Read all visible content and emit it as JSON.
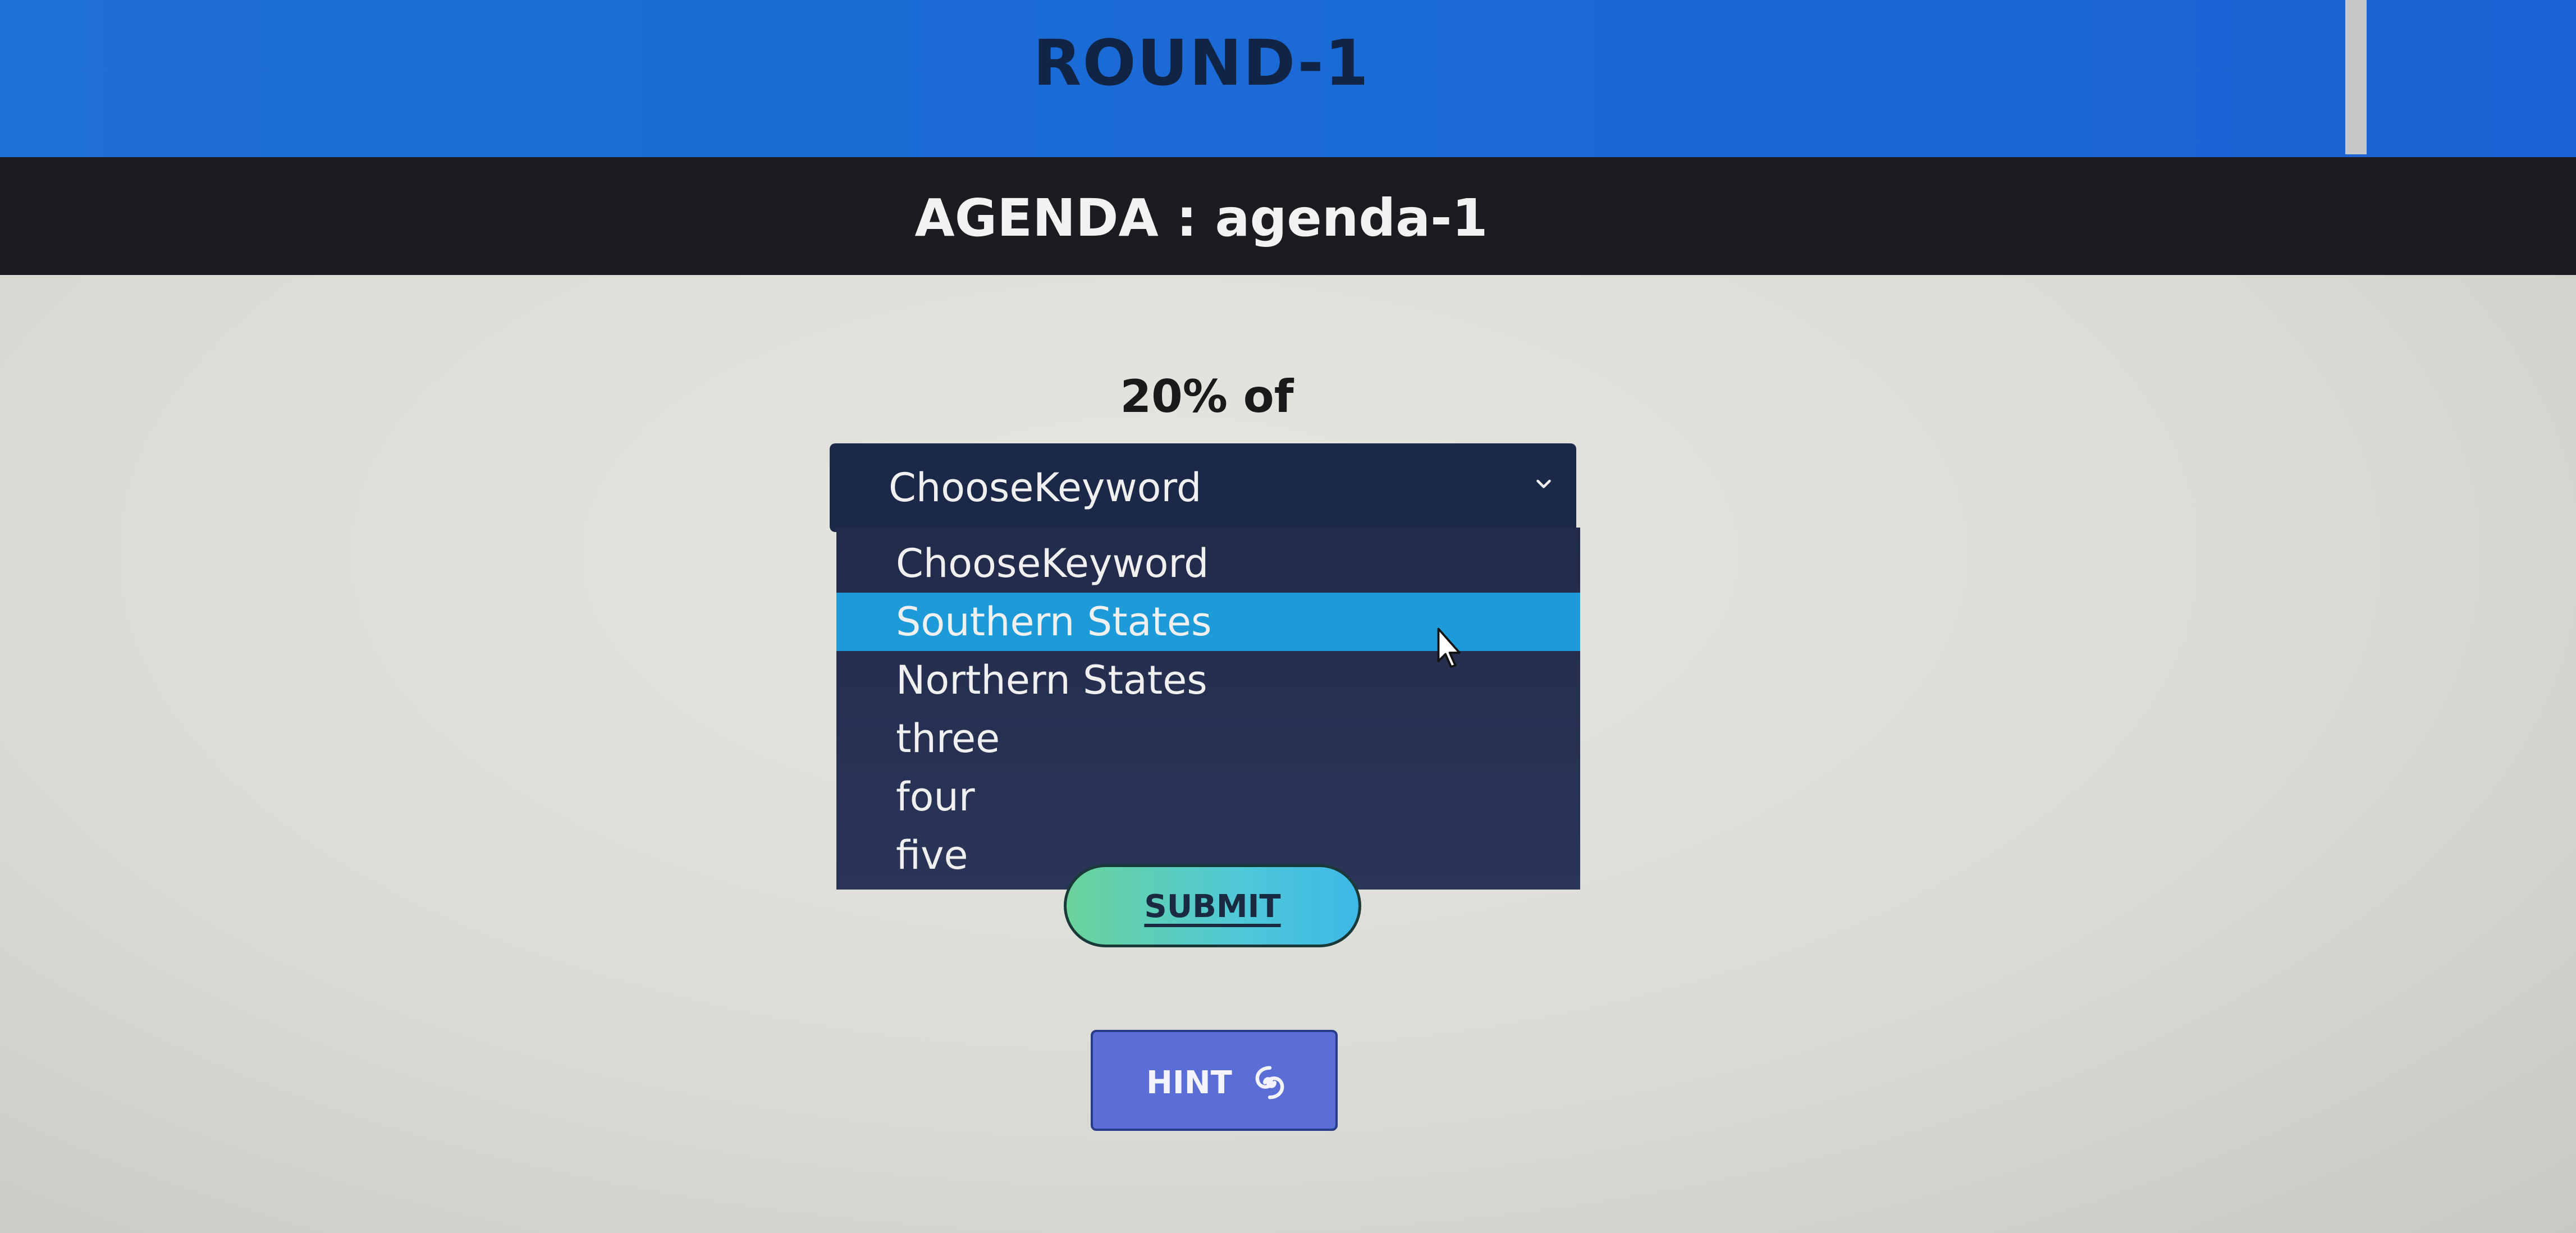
{
  "header": {
    "round_title": "ROUND-1",
    "agenda": "AGENDA : agenda-1"
  },
  "question": {
    "text": "20% of"
  },
  "keyword_select": {
    "selected_value": "ChooseKeyword",
    "options": [
      {
        "label": "ChooseKeyword"
      },
      {
        "label": "Southern States"
      },
      {
        "label": "Northern States"
      },
      {
        "label": "three"
      },
      {
        "label": "four"
      },
      {
        "label": "five"
      }
    ],
    "highlighted_option": "Southern States",
    "icon": "chevron-down-icon"
  },
  "actions": {
    "submit_label": "SUBMIT",
    "hint_label": "HINT",
    "hint_icon": "swirl-icon"
  },
  "colors": {
    "header_blue": "#1e6fd6",
    "agenda_bar": "#1b1b20",
    "select_bg": "#1c2848",
    "highlight": "#1d9bd8",
    "hint_button": "#5a6ed6"
  }
}
